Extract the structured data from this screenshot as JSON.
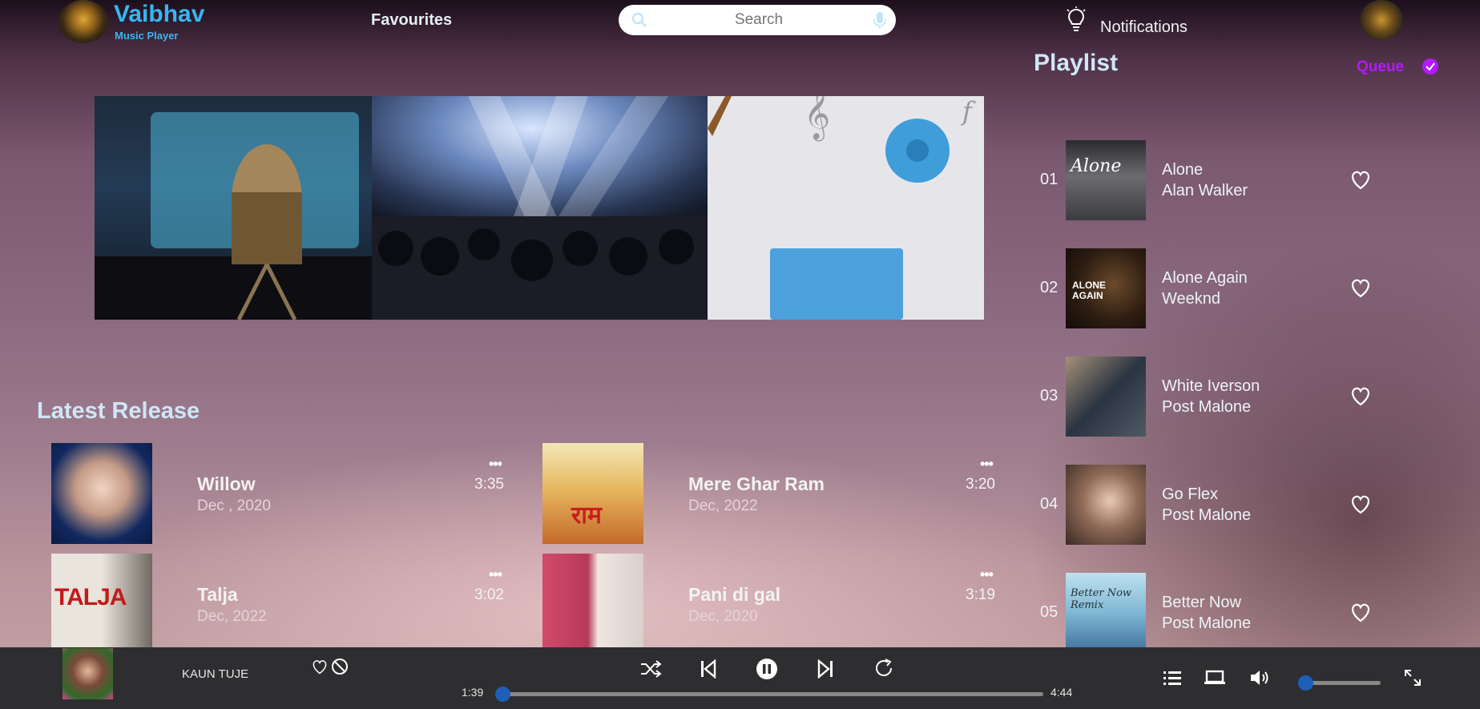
{
  "header": {
    "brand": "Vaibhav",
    "brand_sub": "Music Player",
    "nav_favourites": "Favourites",
    "search_placeholder": "Search",
    "notifications": "Notifications"
  },
  "playlist": {
    "title": "Playlist",
    "queue_label": "Queue",
    "items": [
      {
        "num": "01",
        "title": "Alone",
        "artist": "Alan Walker",
        "cover_text": "Alone"
      },
      {
        "num": "02",
        "title": "Alone Again",
        "artist": "Weeknd",
        "cover_text": "ALONE AGAIN"
      },
      {
        "num": "03",
        "title": "White Iverson",
        "artist": "Post Malone",
        "cover_text": ""
      },
      {
        "num": "04",
        "title": "Go Flex",
        "artist": "Post Malone",
        "cover_text": ""
      },
      {
        "num": "05",
        "title": "Better Now",
        "artist": "Post Malone",
        "cover_text": "Better Now Remix"
      }
    ]
  },
  "latest": {
    "title": "Latest Release",
    "cards": [
      {
        "title": "Willow",
        "date": "Dec , 2020",
        "duration": "3:35",
        "more": "•••",
        "cover_text": ""
      },
      {
        "title": "Mere Ghar Ram",
        "date": "Dec, 2022",
        "duration": "3:20",
        "more": "•••",
        "cover_text": "राम"
      },
      {
        "title": "Talja",
        "date": "Dec, 2022",
        "duration": "3:02",
        "more": "•••",
        "cover_text": "TALJA"
      },
      {
        "title": "Pani di gal",
        "date": "Dec, 2020",
        "duration": "3:19",
        "more": "•••",
        "cover_text": ""
      }
    ]
  },
  "player": {
    "now_playing": "KAUN TUJE",
    "current_time": "1:39",
    "total_time": "4:44",
    "progress": 0.0,
    "volume": 0.0
  },
  "icons": {
    "search": "search-icon",
    "mic": "mic-icon",
    "notifications": "lightbulb-icon",
    "heart": "heart-icon",
    "block": "block-icon",
    "shuffle": "shuffle-icon",
    "previous": "skip-previous-icon",
    "pause": "pause-icon",
    "next": "skip-next-icon",
    "repeat": "repeat-icon",
    "list": "list-icon",
    "device": "laptop-icon",
    "volume": "volume-icon",
    "fullscreen": "fullscreen-icon",
    "queue": "check-circle-icon"
  },
  "colors": {
    "accent": "#37b6f2",
    "queue": "#b31aff",
    "player_bg": "#2e2e31",
    "knob": "#1e5fb8"
  }
}
